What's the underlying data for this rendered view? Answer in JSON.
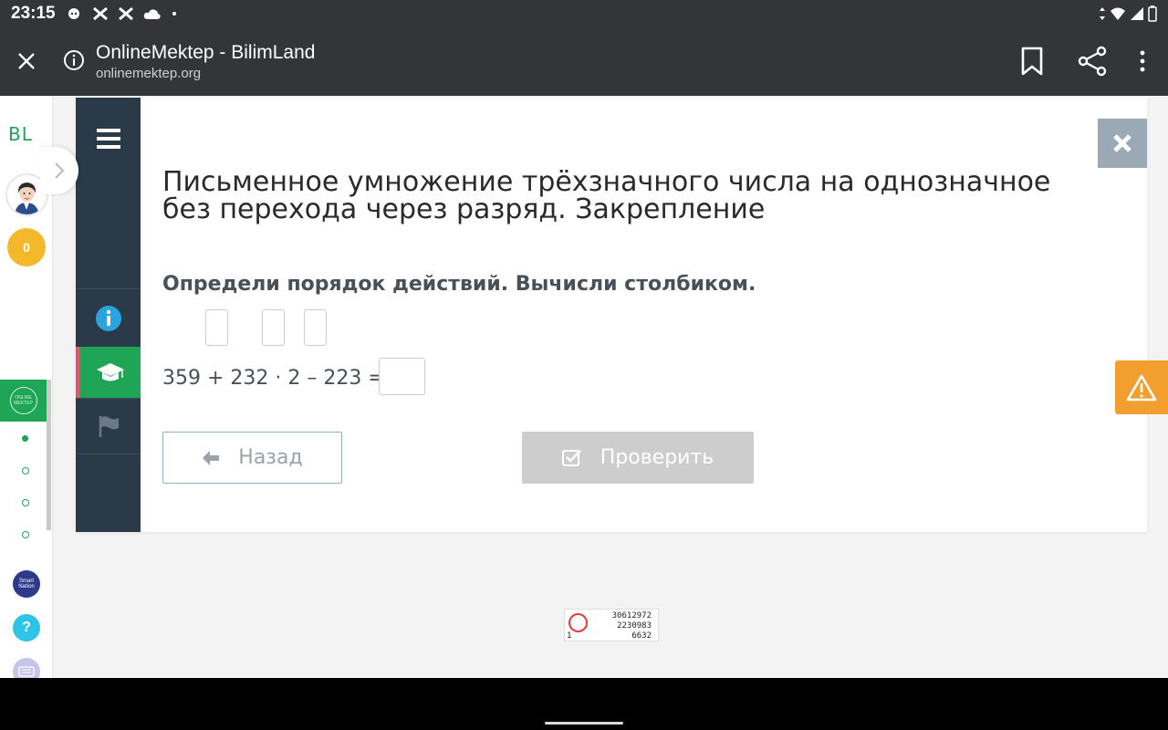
{
  "status_bar": {
    "time": "23:15"
  },
  "browser": {
    "title": "OnlineMektep - BilimLand",
    "url": "onlinemektep.org"
  },
  "rail": {
    "logo": "BL",
    "coins": "0",
    "online_logo": "ONLINE MEKTEP",
    "smart_nation": "Smart Nation",
    "help": "?"
  },
  "lesson": {
    "title": "Письменное умножение трёхзначного числа на однозначное без перехода через разряд. Закрепление",
    "task": "Определи порядок действий. Вычисли столбиком.",
    "expression": "359 + 232 · 2 – 223 =",
    "back_label": "Назад",
    "check_label": "Проверить"
  },
  "stamp": {
    "line1": "30612972",
    "line2": "2230983",
    "line3": "6632",
    "corner": "1"
  },
  "colors": {
    "green": "#1fa556",
    "dark_side": "#2b3a48",
    "warning": "#f29f2f",
    "coin": "#f5b82b"
  }
}
